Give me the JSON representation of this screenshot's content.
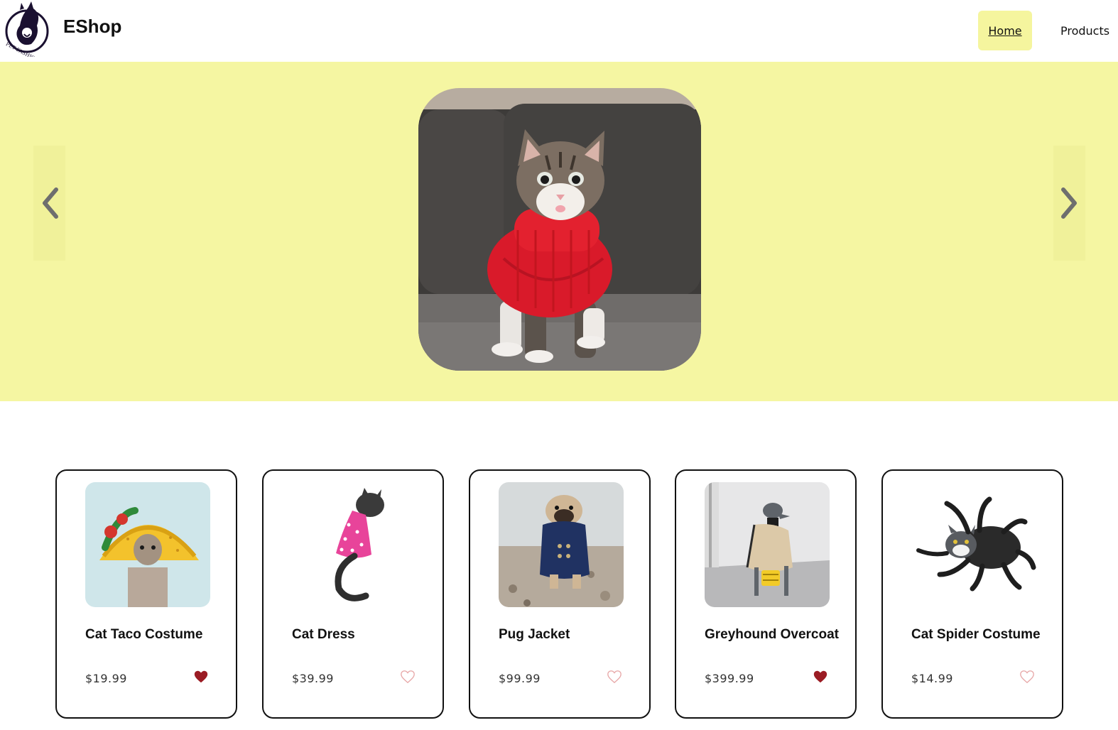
{
  "header": {
    "brand": "EShop",
    "logo_text": "PET FASHION SHOW",
    "nav": [
      {
        "label": "Home",
        "active": true
      },
      {
        "label": "Products",
        "active": false
      }
    ]
  },
  "hero": {
    "background": "#f5f6a2",
    "prev_icon": "chevron-left-icon",
    "next_icon": "chevron-right-icon",
    "slide_description": "kitten in red sweater on couch"
  },
  "products": [
    {
      "name": "Cat Taco Costume",
      "price": "$19.99",
      "favorite": true
    },
    {
      "name": "Cat Dress",
      "price": "$39.99",
      "favorite": false
    },
    {
      "name": "Pug Jacket",
      "price": "$99.99",
      "favorite": false
    },
    {
      "name": "Greyhound Overcoat",
      "price": "$399.99",
      "favorite": true
    },
    {
      "name": "Cat Spider Costume",
      "price": "$14.99",
      "favorite": false
    }
  ],
  "colors": {
    "accent": "#f5f59e",
    "heart_filled": "#9b1c24",
    "heart_outline": "#e8a9a9"
  }
}
